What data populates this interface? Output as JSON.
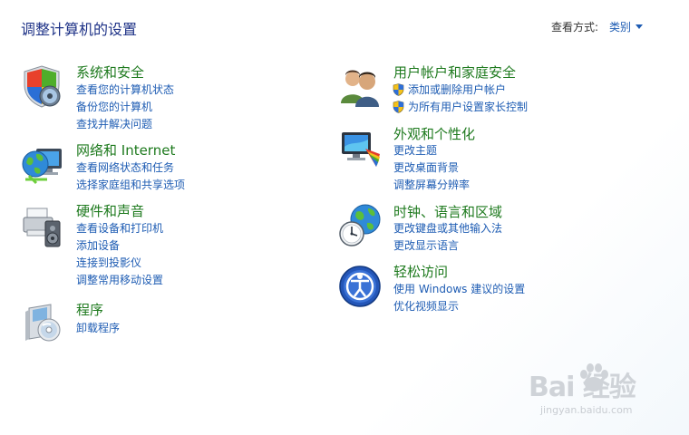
{
  "header": {
    "title": "调整计算机的设置",
    "view_by_label": "查看方式:",
    "view_by_value": "类别"
  },
  "categories": [
    {
      "title": "系统和安全",
      "icon": "system-security-icon",
      "links": [
        "查看您的计算机状态",
        "备份您的计算机",
        "查找并解决问题"
      ]
    },
    {
      "title": "网络和 Internet",
      "icon": "network-internet-icon",
      "links": [
        "查看网络状态和任务",
        "选择家庭组和共享选项"
      ]
    },
    {
      "title": "硬件和声音",
      "icon": "hardware-sound-icon",
      "links": [
        "查看设备和打印机",
        "添加设备",
        "连接到投影仪",
        "调整常用移动设置"
      ]
    },
    {
      "title": "程序",
      "icon": "programs-icon",
      "links": [
        "卸载程序"
      ]
    },
    {
      "title": "用户帐户和家庭安全",
      "icon": "user-accounts-icon",
      "links": [
        "添加或删除用户帐户",
        "为所有用户设置家长控制"
      ]
    },
    {
      "title": "外观和个性化",
      "icon": "appearance-icon",
      "links": [
        "更改主题",
        "更改桌面背景",
        "调整屏幕分辨率"
      ]
    },
    {
      "title": "时钟、语言和区域",
      "icon": "clock-language-region-icon",
      "links": [
        "更改键盘或其他输入法",
        "更改显示语言"
      ]
    },
    {
      "title": "轻松访问",
      "icon": "ease-of-access-icon",
      "links": [
        "使用 Windows 建议的设置",
        "优化视频显示"
      ]
    }
  ],
  "watermark": {
    "logo_text": "Bai  经验",
    "url": "jingyan.baidu.com"
  },
  "colors": {
    "title": "#1e3287",
    "category": "#1e7a1e",
    "link": "#1e5cb3"
  }
}
